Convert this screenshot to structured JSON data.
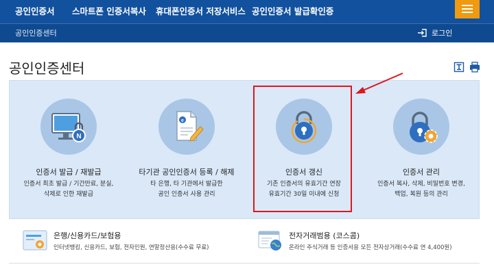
{
  "nav": {
    "items": [
      "공인인증서",
      "스마트폰 인증서복사",
      "휴대폰인증서 저장서비스",
      "공인인증서 발급확인증"
    ],
    "menu_icon": "hamburger-icon"
  },
  "subbar": {
    "breadcrumb": "공인인증센터",
    "login_label": "로그인",
    "login_icon": "login-icon"
  },
  "page": {
    "title": "공인인증센터",
    "tool_icons": [
      "text-size-icon",
      "print-icon"
    ]
  },
  "cards": [
    {
      "icon": "monitor-lock-icon",
      "title": "인증서 발급 / 재발급",
      "desc_line1": "인증서 최초 발급 / 기간만료, 분실,",
      "desc_line2": "삭제로 인한 재발급"
    },
    {
      "icon": "document-pen-icon",
      "title": "타기관 공인인증서 등록 / 해제",
      "desc_line1": "타 은행, 타 기관에서 발급한",
      "desc_line2": "공인 인증서 사용 관리"
    },
    {
      "icon": "lock-renew-icon",
      "title": "인증서 갱신",
      "desc_line1": "기존 인증서의 유효기간 연장",
      "desc_line2": "유효기간 30일 이내에 신청"
    },
    {
      "icon": "lock-gear-icon",
      "title": "인증서 관리",
      "desc_line1": "인증서 복사, 삭제, 비밀번호 변경,",
      "desc_line2": "백업, 복원 등의 관리"
    }
  ],
  "services": [
    {
      "icon": "card-icon",
      "title": "은행/신용카드/보험용",
      "desc": "인터넷뱅킹, 신용카드, 보험, 전자민원, 연말정산용(수수료 무료)"
    },
    {
      "icon": "browser-globe-icon",
      "title": "전자거래범용 (코스콤)",
      "desc": "온라인 주식거래 등 인증서용 모든 전자상거래(수수료 연 4,400원)"
    }
  ],
  "colors": {
    "nav_bg": "#12519e",
    "subbar_bg": "#0f4a90",
    "menu_accent": "#f09a10",
    "panel_bg": "#dae8f8",
    "highlight_red": "#e0151b"
  }
}
